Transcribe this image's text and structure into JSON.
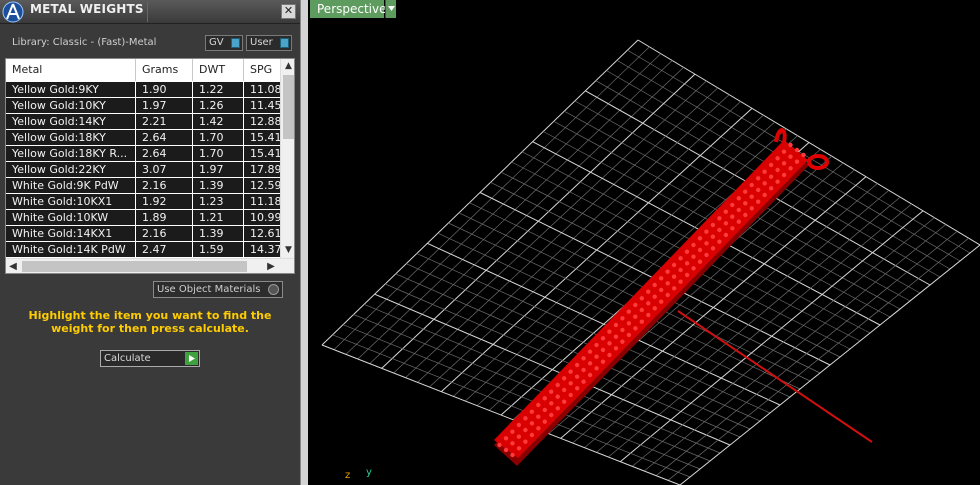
{
  "panel": {
    "title": "METAL WEIGHTS",
    "close_symbol": "✕",
    "library_label": "Library: Classic - (Fast)-Metal",
    "gv_label": "GV",
    "user_label": "User",
    "use_object_materials_label": "Use Object Materials",
    "instruction": "Highlight the item you want to find the weight for then press calculate.",
    "calculate_label": "Calculate"
  },
  "table": {
    "columns": [
      "Metal",
      "Grams",
      "DWT",
      "SPG"
    ],
    "rows": [
      [
        "Yellow Gold:9KY",
        "1.90",
        "1.22",
        "11.08"
      ],
      [
        "Yellow Gold:10KY",
        "1.97",
        "1.26",
        "11.45"
      ],
      [
        "Yellow Gold:14KY",
        "2.21",
        "1.42",
        "12.88"
      ],
      [
        "Yellow Gold:18KY",
        "2.64",
        "1.70",
        "15.41"
      ],
      [
        "Yellow Gold:18KY R...",
        "2.64",
        "1.70",
        "15.41"
      ],
      [
        "Yellow Gold:22KY",
        "3.07",
        "1.97",
        "17.89"
      ],
      [
        "White Gold:9K PdW",
        "2.16",
        "1.39",
        "12.59"
      ],
      [
        "White Gold:10KX1",
        "1.92",
        "1.23",
        "11.18"
      ],
      [
        "White Gold:10KW",
        "1.89",
        "1.21",
        "10.99"
      ],
      [
        "White Gold:14KX1",
        "2.16",
        "1.39",
        "12.61"
      ],
      [
        "White Gold:14K PdW",
        "2.47",
        "1.59",
        "14.37"
      ]
    ]
  },
  "viewport": {
    "view_name": "Perspective",
    "axis_z": "z",
    "axis_y": "y"
  },
  "colors": {
    "accent_yellow": "#ffcc00",
    "view_tab_green": "#5e9b5e",
    "model_red": "#e00000",
    "grid": "#c8c8c8"
  },
  "icons": [
    "app-logo-icon",
    "close-icon",
    "toggle-knob-icon",
    "radio-icon",
    "play-icon",
    "chevron-down-icon",
    "scroll-arrow-icon"
  ]
}
